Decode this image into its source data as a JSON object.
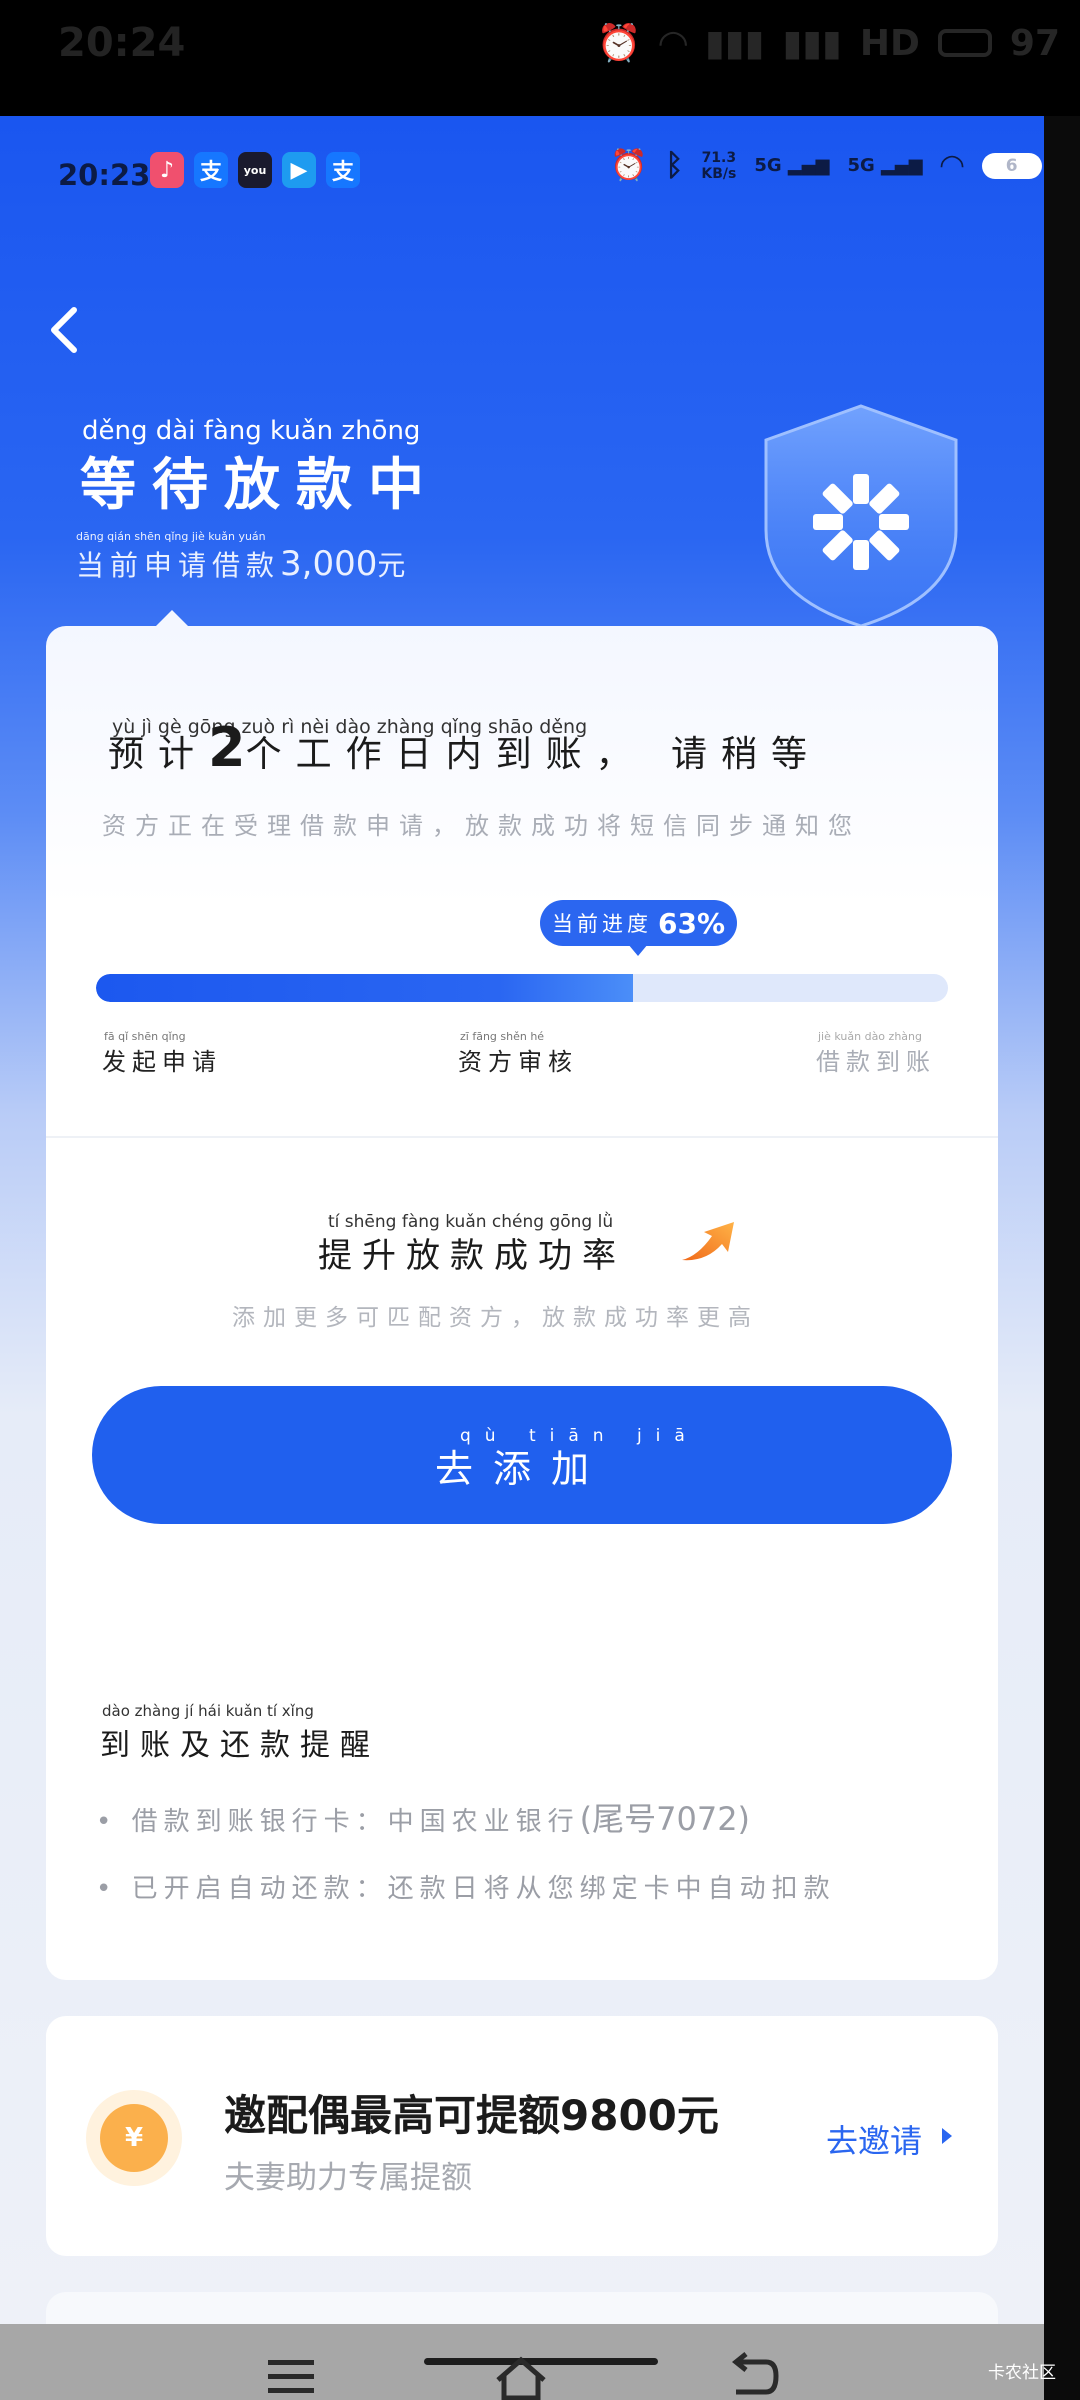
{
  "outer_status": {
    "time": "20:24",
    "hd": "HD",
    "battery": "97"
  },
  "inner_status": {
    "time": "20:23",
    "app_icons": [
      {
        "name": "douyin-icon",
        "glyph": "♪",
        "color": "#f0506e"
      },
      {
        "name": "alipay-icon",
        "glyph": "支",
        "color": "#1677ff"
      },
      {
        "name": "youku-icon",
        "glyph": "you",
        "color": "#1a1a2e"
      },
      {
        "name": "app-icon",
        "glyph": "▶",
        "color": "#1e9bf0"
      },
      {
        "name": "alipay-icon-2",
        "glyph": "支",
        "color": "#1677ff"
      }
    ],
    "speed_value": "71.3",
    "speed_unit": "KB/s",
    "signal1": "5G",
    "signal2": "5G",
    "battery": "6"
  },
  "hero": {
    "title": "等待放款中",
    "title_pinyin": "děng   dài   fàng  kuǎn zhōng",
    "amount_prefix": "当前申请借款",
    "amount": "3,000",
    "amount_suffix": "元",
    "amount_pinyin": "dāng  qián  shēn  qǐng   jiè   kuǎn                      yuán"
  },
  "status_card": {
    "estimate_pre": "预计",
    "estimate_days": "2",
    "estimate_post": "个工作日内到账， 请稍等",
    "estimate_pinyin": "yù     jì          gè    gōng   zuò    rì     nèi   dào  zhàng        qǐng  shāo  děng",
    "estimate_sub": "资方正在受理借款申请，放款成功将短信同步通知您",
    "progress_label": "当前进度",
    "progress_pct": "63%",
    "progress_value": 0.63,
    "steps": [
      {
        "label": "发起申请",
        "pinyin": "fā   qǐ   shēn  qǐng",
        "active": true
      },
      {
        "label": "资方审核",
        "pinyin": "zī  fāng  shěn  hé",
        "active": true
      },
      {
        "label": "借款到账",
        "pinyin": "jiè  kuǎn  dào zhàng",
        "active": false
      }
    ]
  },
  "boost": {
    "title": "提升放款成功率",
    "title_pinyin": "tí    shēng  fàng  kuǎn  chéng  gōng   lǜ",
    "sub": "添加更多可匹配资方，放款成功率更高",
    "button_label": "去添加",
    "button_pinyin": "qù  tiān  jiā"
  },
  "reminder": {
    "title": "到账及还款提醒",
    "title_pinyin": "dào zhàng  jí    hái  kuǎn   tí   xǐng",
    "bank_label": "借款到账银行卡：中国农业银行",
    "bank_tail": "(尾号7072)",
    "repay_label": "已开启自动还款：还款日将从您绑定卡中自动扣款"
  },
  "invite": {
    "coin": "¥",
    "title": "邀配偶最高可提额9800元",
    "sub": "夫妻助力专属提额",
    "link": "去邀请"
  },
  "watermark": "卡农社区"
}
